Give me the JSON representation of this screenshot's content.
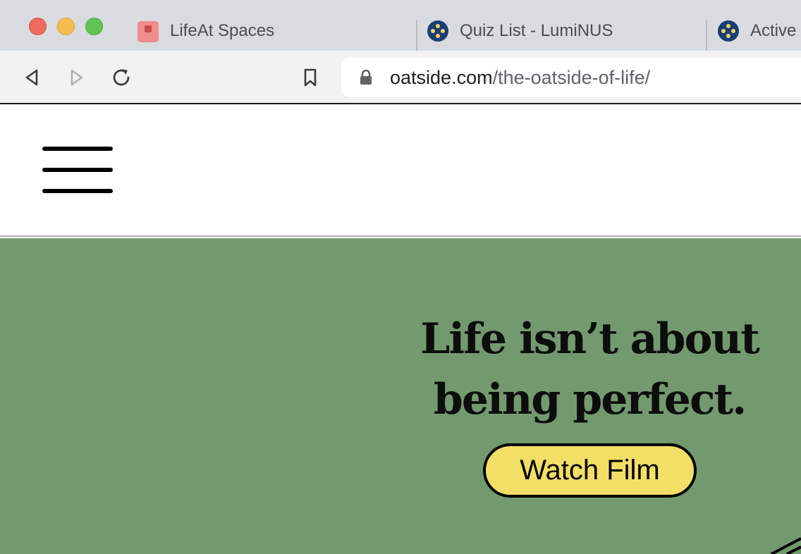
{
  "browser": {
    "window_controls": {
      "close": "close",
      "minimize": "minimize",
      "zoom": "zoom"
    },
    "tabs": [
      {
        "title": "LifeAt Spaces",
        "icon": "lifeat-favicon"
      },
      {
        "title": "Quiz List - LumiNUS",
        "icon": "luminus-favicon"
      },
      {
        "title": "Active",
        "icon": "luminus-favicon"
      }
    ],
    "address_bar": {
      "domain": "oatside.com",
      "path": "/the-oatside-of-life/"
    }
  },
  "page": {
    "headline_line1": "Life isn’t about",
    "headline_line2": "being perfect.",
    "cta_label": "Watch Film"
  },
  "colors": {
    "hero_background": "#739a6f",
    "cta_background": "#f3df65",
    "tabstrip_background": "#d8dbdf"
  }
}
